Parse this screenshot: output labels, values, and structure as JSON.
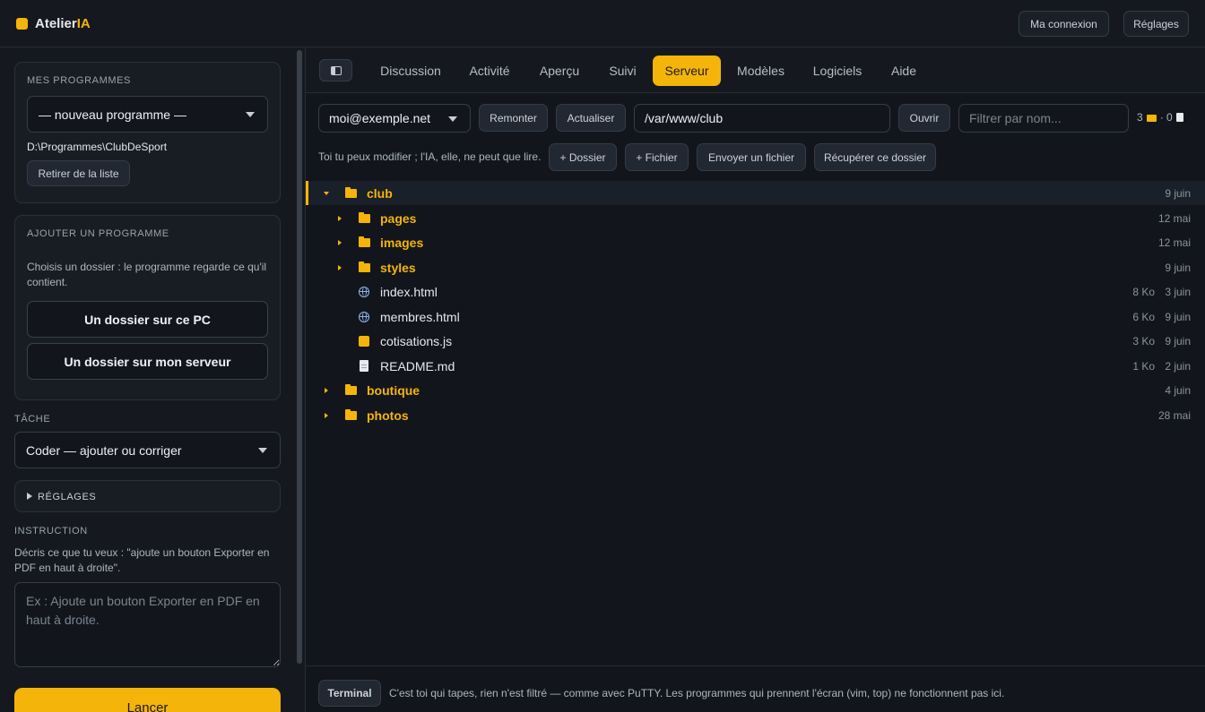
{
  "brand": {
    "name_main": "Atelier",
    "name_accent": "IA"
  },
  "topbar": {
    "connection_label": "Ma connexion",
    "settings_label": "Réglages"
  },
  "sidebar": {
    "programs": {
      "title": "MES PROGRAMMES",
      "selected": "— nouveau programme —",
      "path": "D:\\Programmes\\ClubDeSport",
      "remove_label": "Retirer de la liste"
    },
    "add_program": {
      "title": "AJOUTER UN PROGRAMME",
      "description": "Choisis un dossier : le programme regarde ce qu'il contient.",
      "local_button": "Un dossier sur ce PC",
      "server_button": "Un dossier sur mon serveur"
    },
    "task": {
      "title": "TÂCHE",
      "selected": "Coder — ajouter ou corriger"
    },
    "settings": {
      "title": "RÉGLAGES"
    },
    "instruction": {
      "title": "INSTRUCTION",
      "description": "Décris ce que tu veux : \"ajoute un bouton Exporter en PDF en haut à droite\".",
      "placeholder": "Ex : Ajoute un bouton Exporter en PDF en haut à droite."
    },
    "launch_label": "Lancer"
  },
  "tabs": [
    "Discussion",
    "Activité",
    "Aperçu",
    "Suivi",
    "Serveur",
    "Modèles",
    "Logiciels",
    "Aide"
  ],
  "active_tab": "Serveur",
  "toolbar": {
    "account": "moi@exemple.net",
    "up_label": "Remonter",
    "refresh_label": "Actualiser",
    "path_value": "/var/www/club",
    "open_label": "Ouvrir",
    "filter_placeholder": "Filtrer par nom...",
    "folder_count": "3",
    "file_count": "· 0",
    "permission_note": "Toi tu peux modifier ; l'IA, elle, ne peut que lire.",
    "new_folder_label": "+ Dossier",
    "new_file_label": "+ Fichier",
    "upload_label": "Envoyer un fichier",
    "download_label": "Récupérer ce dossier"
  },
  "tree": [
    {
      "name": "club",
      "type": "dir",
      "expanded": true,
      "depth": 0,
      "size": "",
      "date": "9 juin",
      "selected": true
    },
    {
      "name": "pages",
      "type": "dir",
      "expanded": false,
      "depth": 1,
      "size": "",
      "date": "12 mai"
    },
    {
      "name": "images",
      "type": "dir",
      "expanded": false,
      "depth": 1,
      "size": "",
      "date": "12 mai"
    },
    {
      "name": "styles",
      "type": "dir",
      "expanded": false,
      "depth": 1,
      "size": "",
      "date": "9 juin"
    },
    {
      "name": "index.html",
      "type": "html",
      "depth": 1,
      "size": "8 Ko",
      "date": "3 juin"
    },
    {
      "name": "membres.html",
      "type": "html",
      "depth": 1,
      "size": "6 Ko",
      "date": "9 juin"
    },
    {
      "name": "cotisations.js",
      "type": "js",
      "depth": 1,
      "size": "3 Ko",
      "date": "9 juin"
    },
    {
      "name": "README.md",
      "type": "doc",
      "depth": 1,
      "size": "1 Ko",
      "date": "2 juin"
    },
    {
      "name": "boutique",
      "type": "dir",
      "expanded": false,
      "depth": 0,
      "size": "",
      "date": "4 juin"
    },
    {
      "name": "photos",
      "type": "dir",
      "expanded": false,
      "depth": 0,
      "size": "",
      "date": "28 mai"
    }
  ],
  "terminal": {
    "button_label": "Terminal",
    "note": "C'est toi qui tapes, rien n'est filtré — comme avec PuTTY. Les programmes qui prennent l'écran (vim, top) ne fonctionnent pas ici."
  },
  "colors": {
    "accent": "#f5b40a",
    "background": "#12161c",
    "panel": "#15191f"
  }
}
